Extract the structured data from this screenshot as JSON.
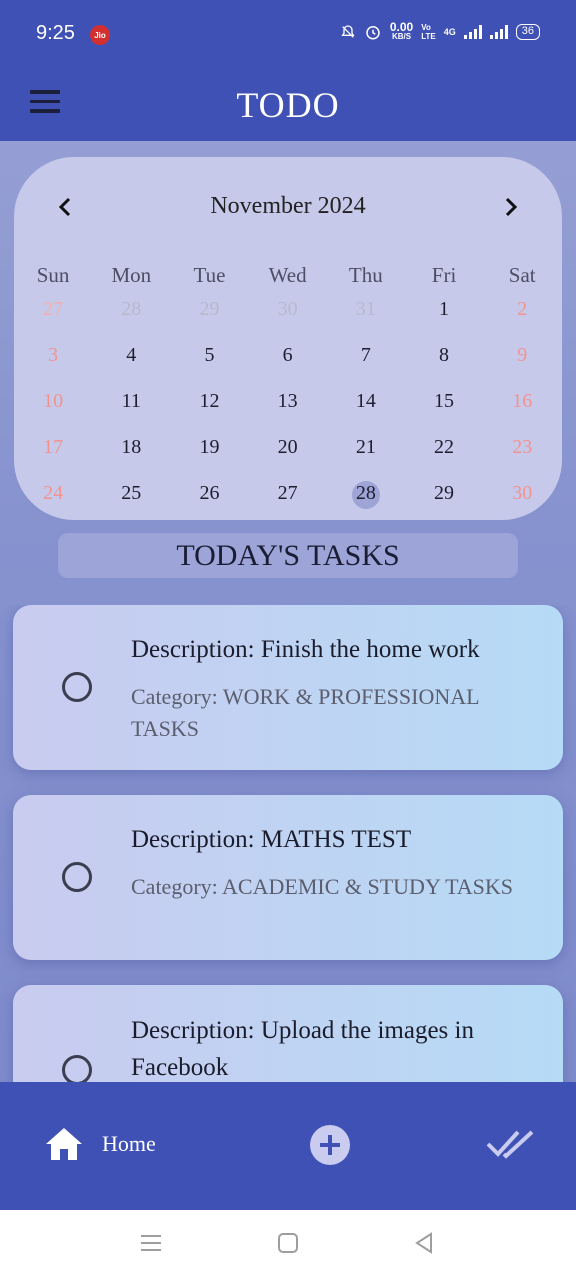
{
  "status_bar": {
    "time": "9:25",
    "carrier": "Jio",
    "net_speed_value": "0.00",
    "net_speed_unit": "KB/S",
    "volte_top": "Vo",
    "volte_bottom": "LTE",
    "network": "4G",
    "battery": "36"
  },
  "app_bar": {
    "title": "TODO"
  },
  "calendar": {
    "month_label": "November 2024",
    "weekdays": [
      "Sun",
      "Mon",
      "Tue",
      "Wed",
      "Thu",
      "Fri",
      "Sat"
    ],
    "weeks": [
      [
        "27",
        "28",
        "29",
        "30",
        "31",
        "1",
        "2"
      ],
      [
        "3",
        "4",
        "5",
        "6",
        "7",
        "8",
        "9"
      ],
      [
        "10",
        "11",
        "12",
        "13",
        "14",
        "15",
        "16"
      ],
      [
        "17",
        "18",
        "19",
        "20",
        "21",
        "22",
        "23"
      ],
      [
        "24",
        "25",
        "26",
        "27",
        "28",
        "29",
        "30"
      ]
    ],
    "selected_day": "28"
  },
  "tasks_heading": "TODAY'S TASKS",
  "tasks": [
    {
      "description_label": "Description: Finish the home work",
      "category_label": "Category: WORK & PROFESSIONAL TASKS"
    },
    {
      "description_label": "Description: MATHS TEST",
      "category_label": "Category: ACADEMIC & STUDY TASKS"
    },
    {
      "description_label": "Description: Upload the images in Facebook",
      "category_label": ""
    }
  ],
  "bottom_nav": {
    "home_label": "Home"
  },
  "colors": {
    "primary": "#3f51b5",
    "calendar_bg": "#c6c9ea",
    "weekend": "#f1948f"
  }
}
